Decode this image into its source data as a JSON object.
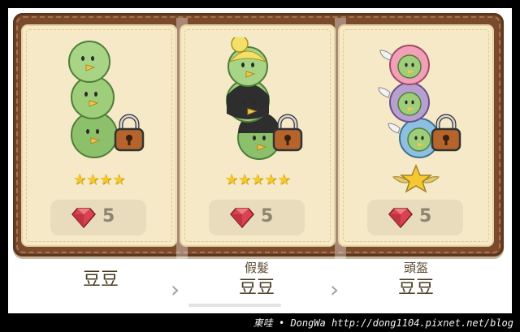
{
  "cards": [
    {
      "id": "card-1",
      "stars": 4,
      "price": "5",
      "locked": true
    },
    {
      "id": "card-2",
      "stars": 5,
      "price": "5",
      "locked": true
    },
    {
      "id": "card-3",
      "stars": 0,
      "price": "5",
      "locked": true,
      "badge": "winged-star"
    }
  ],
  "names": [
    {
      "top": "",
      "main": "豆豆"
    },
    {
      "top": "假髮",
      "main": "豆豆"
    },
    {
      "top": "頭盔",
      "main": "豆豆"
    }
  ],
  "nav": {
    "arrow": "›"
  },
  "watermark": "東哇 • DongWa http://dong1104.pixnet.net/blog",
  "colors": {
    "frame": "#7a4a2c",
    "card": "#f5e9c8",
    "star": "#f6c731",
    "gem": "#d9434e",
    "lock": "#b5652b"
  }
}
